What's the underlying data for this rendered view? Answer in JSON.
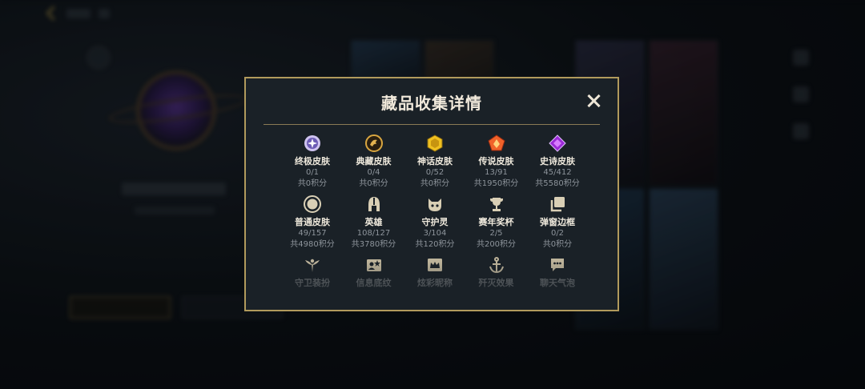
{
  "modal": {
    "title": "藏品收集详情",
    "rows": [
      [
        {
          "icon": "star-diamond-icon",
          "label": "终极皮肤",
          "count": "0/1",
          "points": "共0积分"
        },
        {
          "icon": "dragon-badge-icon",
          "label": "典藏皮肤",
          "count": "0/4",
          "points": "共0积分"
        },
        {
          "icon": "gold-hexagon-icon",
          "label": "神话皮肤",
          "count": "0/52",
          "points": "共0积分"
        },
        {
          "icon": "orange-pentagon-icon",
          "label": "传说皮肤",
          "count": "13/91",
          "points": "共1950积分"
        },
        {
          "icon": "purple-gem-icon",
          "label": "史诗皮肤",
          "count": "45/412",
          "points": "共5580积分"
        }
      ],
      [
        {
          "icon": "circle-badge-icon",
          "label": "普通皮肤",
          "count": "49/157",
          "points": "共4980积分"
        },
        {
          "icon": "helmet-icon",
          "label": "英雄",
          "count": "108/127",
          "points": "共3780积分"
        },
        {
          "icon": "guardian-pet-icon",
          "label": "守护灵",
          "count": "3/104",
          "points": "共120积分"
        },
        {
          "icon": "trophy-icon",
          "label": "赛年奖杯",
          "count": "2/5",
          "points": "共200积分"
        },
        {
          "icon": "stacked-cards-icon",
          "label": "弹窗边框",
          "count": "0/2",
          "points": "共0积分"
        }
      ],
      [
        {
          "icon": "wings-emblem-icon",
          "label": "守卫装扮"
        },
        {
          "icon": "profile-card-icon",
          "label": "信息底纹"
        },
        {
          "icon": "crown-frame-icon",
          "label": "炫彩昵称"
        },
        {
          "icon": "anchor-icon",
          "label": "歼灭效果"
        },
        {
          "icon": "chat-bubble-icon",
          "label": "聊天气泡"
        }
      ]
    ]
  },
  "colors": {
    "modal_border": "#b19a5c",
    "modal_bg": "#1a2127",
    "title": "#f2eadc"
  }
}
